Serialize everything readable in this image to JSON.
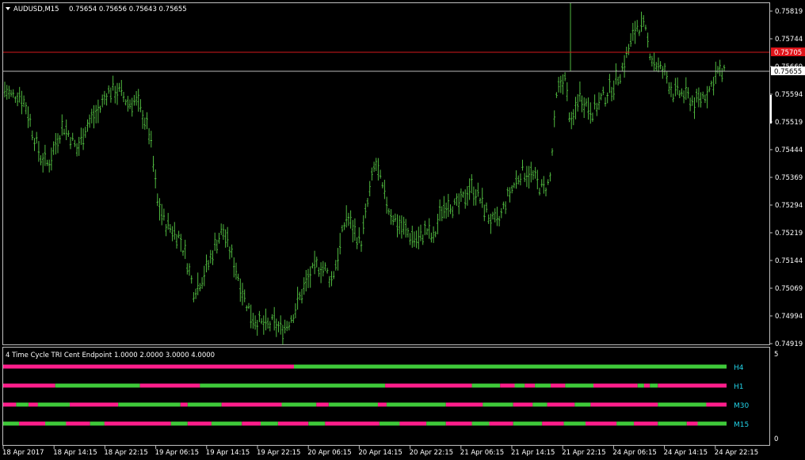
{
  "header": {
    "symbol": "AUDUSD,M15",
    "ohlc": "0.75654 0.75656 0.75643 0.75655"
  },
  "indicator": {
    "title": "4 Time Cycle TRI Cent Endpoint  1.0000 2.0000 3.0000 4.0000",
    "scale_top": "5",
    "scale_bottom": "0",
    "rows": [
      {
        "label": "H4",
        "segments": [
          [
            0.0,
            0.402,
            "m"
          ],
          [
            0.402,
            1.0,
            "g"
          ]
        ]
      },
      {
        "label": "H1",
        "segments": [
          [
            0.0,
            0.072,
            "m"
          ],
          [
            0.072,
            0.189,
            "g"
          ],
          [
            0.189,
            0.272,
            "m"
          ],
          [
            0.272,
            0.528,
            "g"
          ],
          [
            0.528,
            0.648,
            "m"
          ],
          [
            0.648,
            0.687,
            "g"
          ],
          [
            0.687,
            0.707,
            "m"
          ],
          [
            0.707,
            0.721,
            "g"
          ],
          [
            0.721,
            0.735,
            "m"
          ],
          [
            0.735,
            0.757,
            "g"
          ],
          [
            0.757,
            0.777,
            "m"
          ],
          [
            0.777,
            0.816,
            "g"
          ],
          [
            0.816,
            0.877,
            "m"
          ],
          [
            0.877,
            0.886,
            "g"
          ],
          [
            0.886,
            0.894,
            "m"
          ],
          [
            0.894,
            0.905,
            "g"
          ],
          [
            0.905,
            1.0,
            "m"
          ]
        ]
      },
      {
        "label": "M30",
        "segments": [
          [
            0.0,
            0.018,
            "m"
          ],
          [
            0.018,
            0.035,
            "g"
          ],
          [
            0.035,
            0.048,
            "m"
          ],
          [
            0.048,
            0.092,
            "g"
          ],
          [
            0.092,
            0.159,
            "m"
          ],
          [
            0.159,
            0.245,
            "g"
          ],
          [
            0.245,
            0.255,
            "m"
          ],
          [
            0.255,
            0.302,
            "g"
          ],
          [
            0.302,
            0.385,
            "m"
          ],
          [
            0.385,
            0.433,
            "g"
          ],
          [
            0.433,
            0.45,
            "m"
          ],
          [
            0.45,
            0.518,
            "g"
          ],
          [
            0.518,
            0.53,
            "m"
          ],
          [
            0.53,
            0.612,
            "g"
          ],
          [
            0.612,
            0.663,
            "m"
          ],
          [
            0.663,
            0.705,
            "g"
          ],
          [
            0.705,
            0.732,
            "m"
          ],
          [
            0.732,
            0.752,
            "g"
          ],
          [
            0.752,
            0.79,
            "m"
          ],
          [
            0.79,
            0.812,
            "g"
          ],
          [
            0.812,
            0.905,
            "m"
          ],
          [
            0.905,
            0.972,
            "g"
          ],
          [
            0.972,
            1.0,
            "m"
          ]
        ]
      },
      {
        "label": "M15",
        "segments": [
          [
            0.0,
            0.022,
            "g"
          ],
          [
            0.022,
            0.058,
            "m"
          ],
          [
            0.058,
            0.087,
            "g"
          ],
          [
            0.087,
            0.12,
            "m"
          ],
          [
            0.12,
            0.14,
            "g"
          ],
          [
            0.14,
            0.232,
            "m"
          ],
          [
            0.232,
            0.255,
            "g"
          ],
          [
            0.255,
            0.288,
            "m"
          ],
          [
            0.288,
            0.33,
            "g"
          ],
          [
            0.33,
            0.356,
            "m"
          ],
          [
            0.356,
            0.38,
            "g"
          ],
          [
            0.38,
            0.422,
            "m"
          ],
          [
            0.422,
            0.445,
            "g"
          ],
          [
            0.445,
            0.52,
            "m"
          ],
          [
            0.52,
            0.548,
            "g"
          ],
          [
            0.548,
            0.585,
            "m"
          ],
          [
            0.585,
            0.612,
            "g"
          ],
          [
            0.612,
            0.648,
            "m"
          ],
          [
            0.648,
            0.672,
            "g"
          ],
          [
            0.672,
            0.705,
            "m"
          ],
          [
            0.705,
            0.745,
            "g"
          ],
          [
            0.745,
            0.775,
            "m"
          ],
          [
            0.775,
            0.805,
            "g"
          ],
          [
            0.805,
            0.848,
            "m"
          ],
          [
            0.848,
            0.872,
            "g"
          ],
          [
            0.872,
            0.905,
            "m"
          ],
          [
            0.905,
            0.945,
            "g"
          ],
          [
            0.945,
            0.96,
            "m"
          ],
          [
            0.96,
            1.0,
            "g"
          ]
        ]
      }
    ]
  },
  "price_axis": {
    "ticks": [
      "0.75819",
      "0.75744",
      "0.75669",
      "0.75594",
      "0.75519",
      "0.75444",
      "0.75369",
      "0.75294",
      "0.75219",
      "0.75144",
      "0.75069",
      "0.74994",
      "0.74919"
    ],
    "ask_line_label": "0.75705",
    "bid_line_label": "0.75655"
  },
  "time_axis": {
    "labels": [
      "18 Apr 2017",
      "18 Apr 14:15",
      "18 Apr 22:15",
      "19 Apr 06:15",
      "19 Apr 14:15",
      "19 Apr 22:15",
      "20 Apr 06:15",
      "20 Apr 14:15",
      "20 Apr 22:15",
      "21 Apr 06:15",
      "21 Apr 14:15",
      "21 Apr 22:15",
      "24 Apr 06:15",
      "24 Apr 14:15",
      "24 Apr 22:15"
    ]
  },
  "colors": {
    "candle": "#4fb83f",
    "magenta": "#ff1e8c",
    "green": "#3fca3a",
    "ask_line": "#d4181c",
    "bid_line": "#b8b8b8",
    "label": "#22d3e8"
  },
  "chart_data": {
    "type": "line",
    "title": "AUDUSD,M15",
    "xlabel": "",
    "ylabel": "",
    "ylim": [
      0.749,
      0.7585
    ],
    "x": [
      "18 Apr 2017",
      "18 Apr 14:15",
      "18 Apr 22:15",
      "19 Apr 06:15",
      "19 Apr 14:15",
      "19 Apr 22:15",
      "20 Apr 06:15",
      "20 Apr 14:15",
      "20 Apr 22:15",
      "21 Apr 06:15",
      "21 Apr 14:15",
      "21 Apr 22:15",
      "24 Apr 06:15",
      "24 Apr 14:15",
      "24 Apr 22:15"
    ],
    "series": [
      {
        "values": [
          0.756,
          0.7549,
          0.756,
          0.7528,
          0.7518,
          0.7497,
          0.751,
          0.753,
          0.7522,
          0.7535,
          0.7542,
          0.7555,
          0.7577,
          0.7559,
          0.7566
        ]
      }
    ],
    "grid": false
  }
}
